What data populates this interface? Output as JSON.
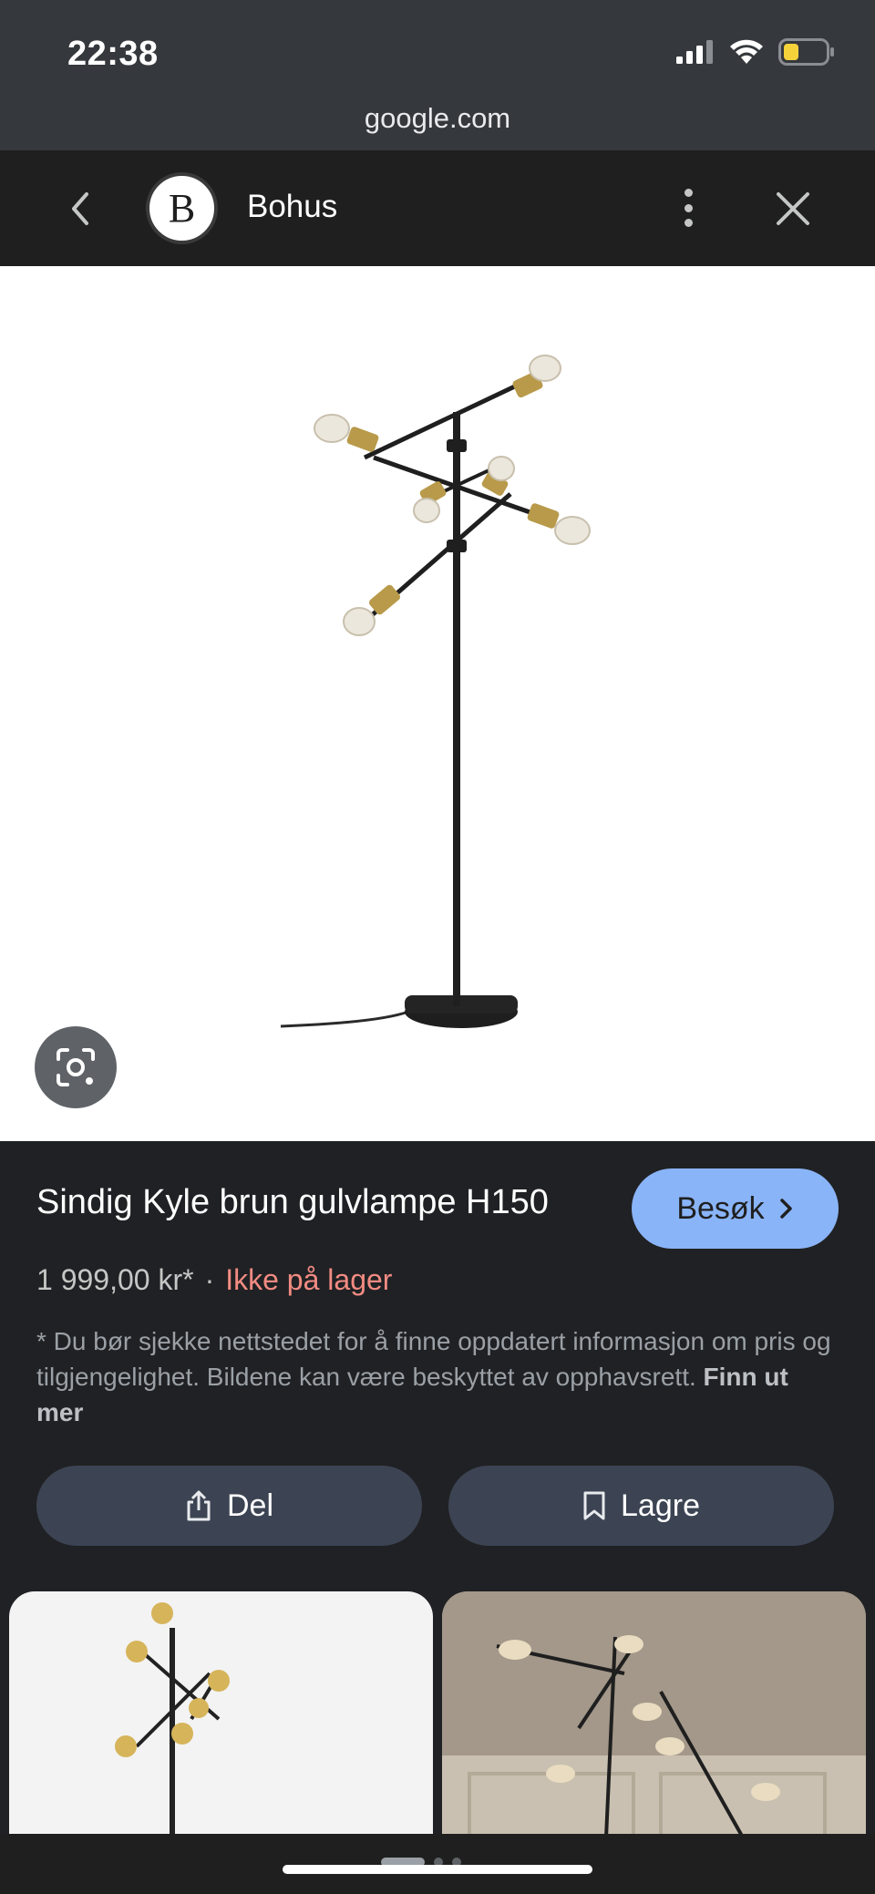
{
  "status_bar": {
    "time": "22:38",
    "icons": [
      "signal-icon",
      "wifi-icon",
      "battery-icon"
    ]
  },
  "url": "google.com",
  "header": {
    "logo_letter": "B",
    "site_name": "Bohus",
    "icons": [
      "back-arrow-icon",
      "more-vertical-icon",
      "close-icon"
    ]
  },
  "product": {
    "title": "Sindig Kyle brun gulvlampe H150",
    "visit_label": "Besøk",
    "price": "1 999,00 kr*",
    "separator": "·",
    "stock": "Ikke på lager",
    "disclaimer": "* Du bør sjekke nettstedet for å finne oppdatert informasjon om pris og tilgjengelighet. Bildene kan være beskyttet av opphavsrett.",
    "learn_more": "Finn ut mer"
  },
  "actions": {
    "share_label": "Del",
    "save_label": "Lagre"
  },
  "colors": {
    "accent": "#8ab4f8",
    "stock_red": "#f28b82",
    "action_bg": "#3c4453",
    "panel_bg": "#202124"
  }
}
